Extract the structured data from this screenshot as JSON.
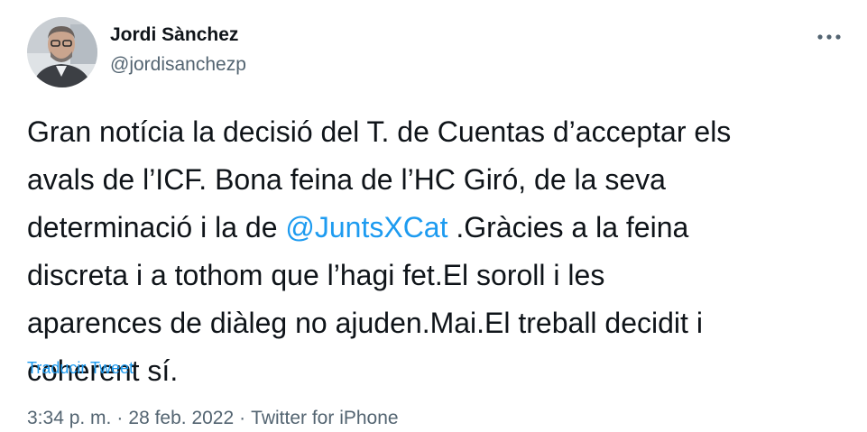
{
  "author": {
    "display_name": "Jordi Sànchez",
    "handle": "@jordisanchezp",
    "avatar_icon": "profile-photo"
  },
  "menu": {
    "more_icon": "more-horizontal-icon",
    "more_symbol": "···"
  },
  "tweet": {
    "text_before_mention": "Gran notícia la decisió del T. de Cuentas d’acceptar els\navals de l’ICF. Bona feina de l’HC Giró, de la seva\ndeterminació i la de ",
    "mention": "@JuntsXCat",
    "text_after_mention": " .Gràcies a la feina\ndiscreta i a tothom que l’hagi fet.El soroll i les\naparences de diàleg no ajuden.Mai.El treball decidit i\ncoherent sí.",
    "translate_label": "Traducir Tweet"
  },
  "meta": {
    "time": "3:34 p. m.",
    "separator": "·",
    "date": "28 feb. 2022",
    "source": "Twitter for iPhone"
  },
  "colors": {
    "text": "#0f1419",
    "secondary": "#536471",
    "accent": "#1d9bf0"
  }
}
